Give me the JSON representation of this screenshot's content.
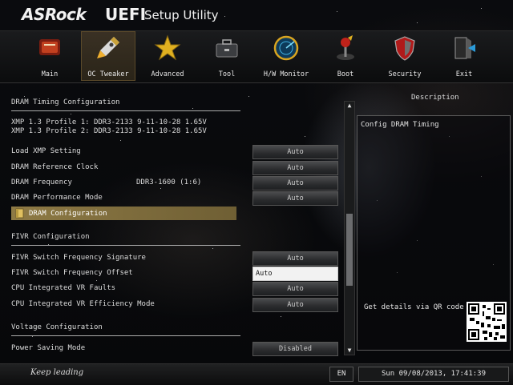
{
  "header": {
    "brand": "ASRock",
    "uefi": "UEFI",
    "subtitle": "Setup Utility"
  },
  "nav": {
    "tabs": [
      {
        "label": "Main",
        "icon": "main-icon",
        "active": false
      },
      {
        "label": "OC Tweaker",
        "icon": "rocket-icon",
        "active": true
      },
      {
        "label": "Advanced",
        "icon": "star-icon",
        "active": false
      },
      {
        "label": "Tool",
        "icon": "toolbox-icon",
        "active": false
      },
      {
        "label": "H/W Monitor",
        "icon": "radar-icon",
        "active": false
      },
      {
        "label": "Boot",
        "icon": "joystick-icon",
        "active": false
      },
      {
        "label": "Security",
        "icon": "shield-icon",
        "active": false
      },
      {
        "label": "Exit",
        "icon": "exit-door-icon",
        "active": false
      }
    ]
  },
  "content": {
    "dram_section": "DRAM Timing Configuration",
    "xmp1": "XMP 1.3 Profile 1: DDR3-2133 9-11-10-28 1.65V",
    "xmp2": "XMP 1.3 Profile 2: DDR3-2133 9-11-10-28 1.65V",
    "rows": [
      {
        "label": "Load XMP Setting",
        "value": "Auto"
      },
      {
        "label": "DRAM Reference Clock",
        "value": "Auto"
      },
      {
        "label": "DRAM Frequency",
        "mid": "DDR3-1600 (1:6)",
        "value": "Auto"
      },
      {
        "label": "DRAM Performance Mode",
        "value": "Auto"
      }
    ],
    "dram_config": "DRAM Configuration",
    "fivr_section": "FIVR Configuration",
    "fivr_rows": [
      {
        "label": "FIVR Switch Frequency Signature",
        "value": "Auto"
      },
      {
        "label": "FIVR Switch Frequency Offset",
        "value": "Auto"
      },
      {
        "label": "CPU Integrated VR Faults",
        "value": "Auto"
      },
      {
        "label": "CPU Integrated VR Efficiency Mode",
        "value": "Auto"
      }
    ],
    "voltage_section": "Voltage Configuration",
    "power_saving": {
      "label": "Power Saving Mode",
      "value": "Disabled"
    }
  },
  "description": {
    "title": "Description",
    "text": "Config DRAM Timing",
    "qr_text": "Get details via QR code"
  },
  "footer": {
    "slogan": "Keep leading",
    "lang": "EN",
    "datetime": "Sun 09/08/2013, 17:41:39"
  },
  "colors": {
    "highlight": "#8e7a45",
    "selected_field": "#f2f2f2"
  }
}
